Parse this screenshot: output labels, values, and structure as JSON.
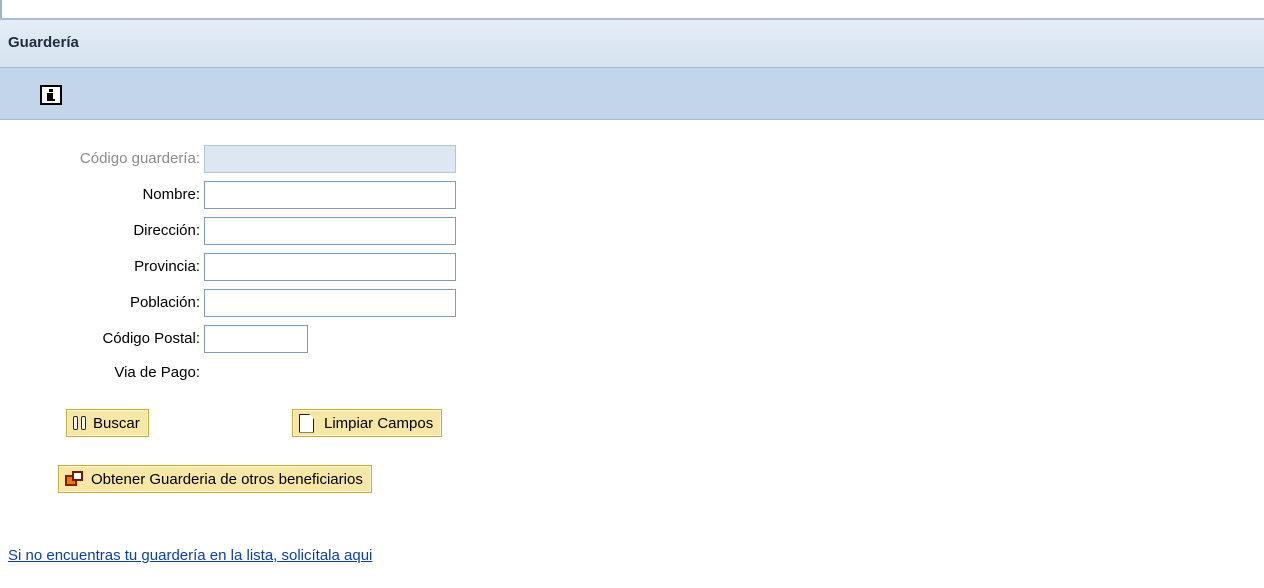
{
  "header": {
    "title": "Guardería"
  },
  "toolbar": {
    "info_icon": "info-icon"
  },
  "form": {
    "codigo_guarderia": {
      "label": "Código guardería:",
      "value": ""
    },
    "nombre": {
      "label": "Nombre:",
      "value": ""
    },
    "direccion": {
      "label": "Dirección:",
      "value": ""
    },
    "provincia": {
      "label": "Provincia:",
      "value": ""
    },
    "poblacion": {
      "label": "Población:",
      "value": ""
    },
    "codigo_postal": {
      "label": "Código Postal:",
      "value": ""
    },
    "via_pago": {
      "label": "Via de Pago:"
    }
  },
  "buttons": {
    "buscar": {
      "label": "Buscar",
      "icon": "binoculars-icon"
    },
    "limpiar": {
      "label": "Limpiar Campos",
      "icon": "new-page-icon"
    },
    "obtener": {
      "label": "Obtener Guarderia de otros beneficiarios",
      "icon": "transfer-icon"
    }
  },
  "link": {
    "text": "Si no encuentras tu guardería en la lista, solicítala aqui"
  },
  "colors": {
    "header_bg": "#dde7f2",
    "toolbar_bg": "#c2d5e9",
    "button_bg": "#f7e7a6",
    "link": "#0a3fa6",
    "readonly_field": "#dce7f2"
  }
}
